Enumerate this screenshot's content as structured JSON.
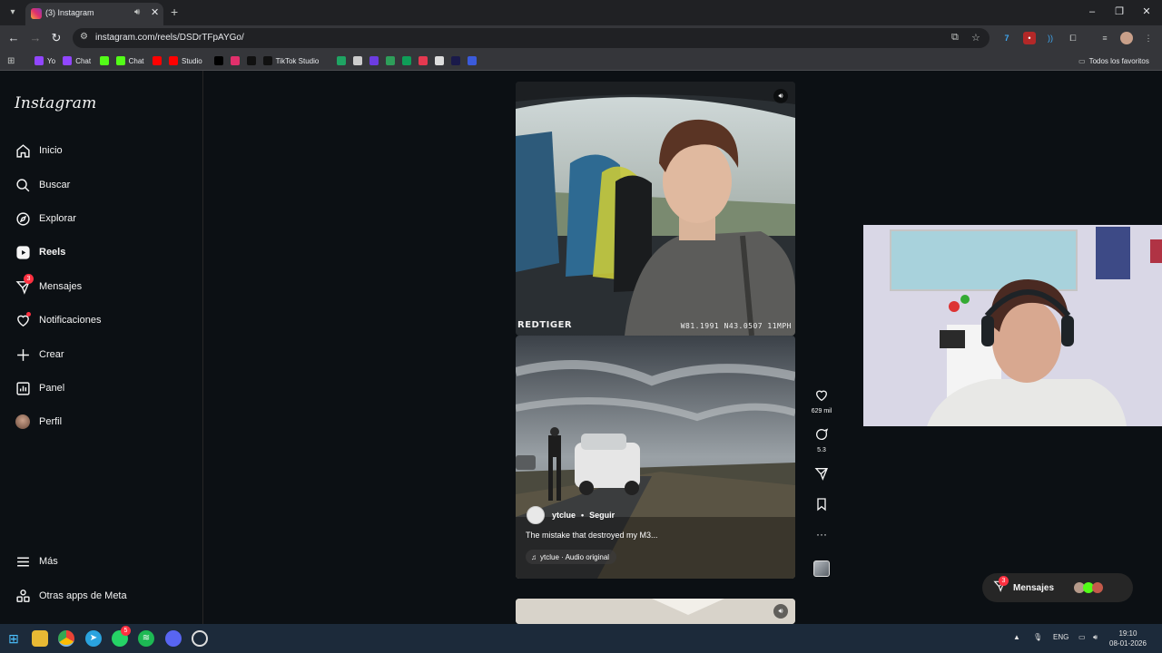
{
  "browser": {
    "tab_title": "(3) Instagram",
    "url": "instagram.com/reels/DSDrTFpAYGo/",
    "bookmarks": [
      {
        "label": "Yo",
        "icon": "twitch-icon",
        "color": "#9146ff"
      },
      {
        "label": "Chat",
        "icon": "twitch-icon",
        "color": "#9146ff"
      },
      {
        "label": "",
        "icon": "kick-icon",
        "color": "#53fc18"
      },
      {
        "label": "Chat",
        "icon": "kick-icon",
        "color": "#53fc18"
      },
      {
        "label": "",
        "icon": "youtube-icon",
        "color": "#ff0000"
      },
      {
        "label": "Studio",
        "icon": "youtube-studio-icon",
        "color": "#ff0000"
      },
      {
        "label": "",
        "icon": "x-icon",
        "color": "#000000"
      },
      {
        "label": "",
        "icon": "instagram-icon",
        "color": "#e1306c"
      },
      {
        "label": "",
        "icon": "tiktok-icon",
        "color": "#111111"
      },
      {
        "label": "TikTok Studio",
        "icon": "tiktok-icon",
        "color": "#111111"
      },
      {
        "label": "",
        "icon": "drive-icon",
        "color": "#1fa463"
      },
      {
        "label": "",
        "icon": "diamond-icon",
        "color": "#cccccc"
      },
      {
        "label": "",
        "icon": "app-icon",
        "color": "#6c3ce0"
      },
      {
        "label": "",
        "icon": "app-icon",
        "color": "#2e9e5a"
      },
      {
        "label": "",
        "icon": "sheets-icon",
        "color": "#0f9d58"
      },
      {
        "label": "",
        "icon": "app-icon",
        "color": "#e53950"
      },
      {
        "label": "",
        "icon": "unity-icon",
        "color": "#dddddd"
      },
      {
        "label": "",
        "icon": "app-icon",
        "color": "#1a1a4a"
      },
      {
        "label": "",
        "icon": "app-icon",
        "color": "#3b5bdb"
      }
    ],
    "all_bookmarks_label": "Todos los favoritos"
  },
  "sidebar": {
    "logo": "Instagram",
    "items": [
      {
        "label": "Inicio",
        "icon": "home-icon"
      },
      {
        "label": "Buscar",
        "icon": "search-icon"
      },
      {
        "label": "Explorar",
        "icon": "compass-icon"
      },
      {
        "label": "Reels",
        "icon": "reels-icon",
        "active": true
      },
      {
        "label": "Mensajes",
        "icon": "messenger-icon",
        "badge": "3"
      },
      {
        "label": "Notificaciones",
        "icon": "heart-icon"
      },
      {
        "label": "Crear",
        "icon": "plus-icon"
      },
      {
        "label": "Panel",
        "icon": "chart-icon"
      },
      {
        "label": "Perfil",
        "icon": "avatar"
      }
    ],
    "more": "Más",
    "meta_apps": "Otras apps de Meta"
  },
  "reel": {
    "dashcam_brand": "REDTIGER",
    "dashcam_gps": "W81.1991 N43.0507 11MPH",
    "username": "ytclue",
    "follow": "Seguir",
    "caption": "The mistake that destroyed my M3...",
    "audio": "ytclue · Audio original",
    "likes": "629 mil",
    "comments": "5.3"
  },
  "messages_pill": {
    "label": "Mensajes",
    "badge": "3"
  },
  "taskbar": {
    "lang": "ENG",
    "time": "19:10",
    "date": "08-01-2026",
    "whatsapp_badge": "5"
  }
}
